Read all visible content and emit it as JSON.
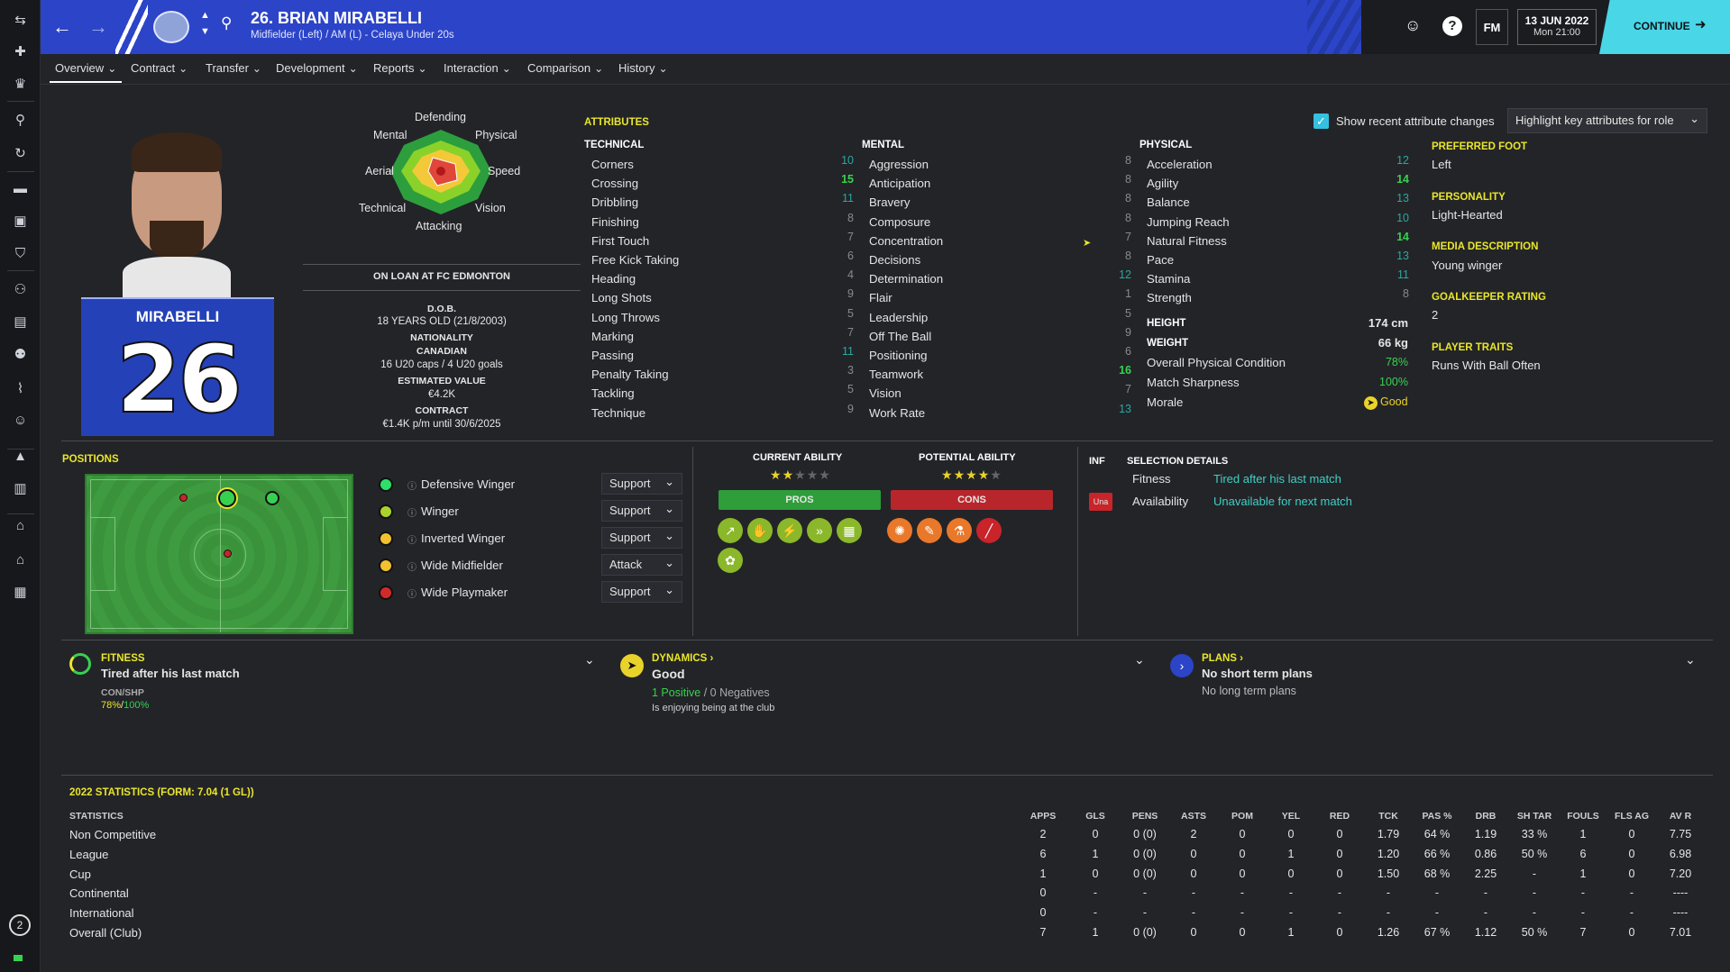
{
  "header": {
    "title": "26. BRIAN MIRABELLI",
    "subtitle": "Midfielder (Left) / AM (L) - Celaya Under 20s",
    "date": "13 JUN 2022",
    "time": "Mon 21:00",
    "fm": "FM",
    "continue": "CONTINUE",
    "help": "?"
  },
  "tabs": [
    "Overview",
    "Contract",
    "Transfer",
    "Development",
    "Reports",
    "Interaction",
    "Comparison",
    "History"
  ],
  "radar": {
    "labels": {
      "top": "Defending",
      "tl": "Mental",
      "tr": "Physical",
      "l": "Aerial",
      "r": "Speed",
      "bl": "Technical",
      "br": "Vision",
      "bottom": "Attacking"
    }
  },
  "loan": "ON LOAN AT FC EDMONTON",
  "info": {
    "dob_label": "D.O.B.",
    "dob": "18 YEARS OLD (21/8/2003)",
    "nat_label": "NATIONALITY",
    "nat": "CANADIAN",
    "caps": "16 U20 caps / 4 U20 goals",
    "value_label": "ESTIMATED VALUE",
    "value": "€4.2K",
    "contract_label": "CONTRACT",
    "contract": "€1.4K p/m until 30/6/2025"
  },
  "shirt": {
    "name": "MIRABELLI",
    "number": "26"
  },
  "attributes": {
    "title": "ATTRIBUTES",
    "show_changes": "Show recent attribute changes",
    "highlight": "Highlight key attributes for role",
    "technical_title": "TECHNICAL",
    "mental_title": "MENTAL",
    "physical_title": "PHYSICAL",
    "technical": [
      [
        "Corners",
        "10"
      ],
      [
        "Crossing",
        "15"
      ],
      [
        "Dribbling",
        "11"
      ],
      [
        "Finishing",
        "8"
      ],
      [
        "First Touch",
        "7"
      ],
      [
        "Free Kick Taking",
        "6"
      ],
      [
        "Heading",
        "4"
      ],
      [
        "Long Shots",
        "9"
      ],
      [
        "Long Throws",
        "5"
      ],
      [
        "Marking",
        "7"
      ],
      [
        "Passing",
        "11"
      ],
      [
        "Penalty Taking",
        "3"
      ],
      [
        "Tackling",
        "5"
      ],
      [
        "Technique",
        "9"
      ]
    ],
    "mental": [
      [
        "Aggression",
        "8"
      ],
      [
        "Anticipation",
        "8"
      ],
      [
        "Bravery",
        "8"
      ],
      [
        "Composure",
        "8"
      ],
      [
        "Concentration",
        "7"
      ],
      [
        "Decisions",
        "8"
      ],
      [
        "Determination",
        "12"
      ],
      [
        "Flair",
        "1"
      ],
      [
        "Leadership",
        "5"
      ],
      [
        "Off The Ball",
        "9"
      ],
      [
        "Positioning",
        "6"
      ],
      [
        "Teamwork",
        "16"
      ],
      [
        "Vision",
        "7"
      ],
      [
        "Work Rate",
        "13"
      ]
    ],
    "physical": [
      [
        "Acceleration",
        "12"
      ],
      [
        "Agility",
        "14"
      ],
      [
        "Balance",
        "13"
      ],
      [
        "Jumping Reach",
        "10"
      ],
      [
        "Natural Fitness",
        "14"
      ],
      [
        "Pace",
        "13"
      ],
      [
        "Stamina",
        "11"
      ],
      [
        "Strength",
        "8"
      ]
    ],
    "height_label": "HEIGHT",
    "height": "174 cm",
    "weight_label": "WEIGHT",
    "weight": "66 kg",
    "opc_label": "Overall Physical Condition",
    "opc": "78%",
    "ms_label": "Match Sharpness",
    "ms": "100%",
    "morale_label": "Morale",
    "morale": "Good"
  },
  "side": {
    "foot_label": "PREFERRED FOOT",
    "foot": "Left",
    "pers_label": "PERSONALITY",
    "pers": "Light-Hearted",
    "media_label": "MEDIA DESCRIPTION",
    "media": "Young winger",
    "gk_label": "GOALKEEPER RATING",
    "gk": "2",
    "traits_label": "PLAYER TRAITS",
    "traits": "Runs With Ball Often"
  },
  "positions": {
    "title": "POSITIONS",
    "roles": [
      {
        "name": "Defensive Winger",
        "duty": "Support",
        "color": "#2ee06a"
      },
      {
        "name": "Winger",
        "duty": "Support",
        "color": "#a9d42b"
      },
      {
        "name": "Inverted Winger",
        "duty": "Support",
        "color": "#f2c12e"
      },
      {
        "name": "Wide Midfielder",
        "duty": "Attack",
        "color": "#f2c12e"
      },
      {
        "name": "Wide Playmaker",
        "duty": "Support",
        "color": "#d22a2a"
      }
    ]
  },
  "ability": {
    "current_label": "CURRENT ABILITY",
    "potential_label": "POTENTIAL ABILITY",
    "current_stars": 2,
    "potential_stars": 4,
    "pros": "PROS",
    "cons": "CONS"
  },
  "selection": {
    "inf": "INF",
    "title": "SELECTION DETAILS",
    "fitness_label": "Fitness",
    "fitness": "Tired after his last match",
    "avail_label": "Availability",
    "avail": "Unavailable for next match",
    "badge": "Una"
  },
  "fitness": {
    "title": "FITNESS",
    "text": "Tired after his last match",
    "con_label": "CON/SHP",
    "con": "78%",
    "shp": "100%"
  },
  "dynamics": {
    "title": "DYNAMICS ›",
    "text": "Good",
    "positive": "1 Positive",
    "negatives": "0 Negatives",
    "note": "Is enjoying being at the club"
  },
  "plans": {
    "title": "PLANS ›",
    "text": "No short term plans",
    "sub": "No long term plans"
  },
  "stats": {
    "title": "2022 STATISTICS (FORM: 7.04 (1 GL))",
    "headers": [
      "STATISTICS",
      "APPS",
      "GLS",
      "PENS",
      "ASTS",
      "POM",
      "YEL",
      "RED",
      "TCK",
      "PAS %",
      "DRB",
      "SH TAR",
      "FOULS",
      "FLS AG",
      "AV R"
    ],
    "rows": [
      [
        "Non Competitive",
        "2",
        "0",
        "0 (0)",
        "2",
        "0",
        "0",
        "0",
        "1.79",
        "64 %",
        "1.19",
        "33 %",
        "1",
        "0",
        "7.75"
      ],
      [
        "League",
        "6",
        "1",
        "0 (0)",
        "0",
        "0",
        "1",
        "0",
        "1.20",
        "66 %",
        "0.86",
        "50 %",
        "6",
        "0",
        "6.98"
      ],
      [
        "Cup",
        "1",
        "0",
        "0 (0)",
        "0",
        "0",
        "0",
        "0",
        "1.50",
        "68 %",
        "2.25",
        "-",
        "1",
        "0",
        "7.20"
      ],
      [
        "Continental",
        "0",
        "-",
        "-",
        "-",
        "-",
        "-",
        "-",
        "-",
        "-",
        "-",
        "-",
        "-",
        "-",
        "----"
      ],
      [
        "International",
        "0",
        "-",
        "-",
        "-",
        "-",
        "-",
        "-",
        "-",
        "-",
        "-",
        "-",
        "-",
        "-",
        "----"
      ],
      [
        "Overall (Club)",
        "7",
        "1",
        "0 (0)",
        "0",
        "0",
        "1",
        "0",
        "1.26",
        "67 %",
        "1.12",
        "50 %",
        "7",
        "0",
        "7.01"
      ]
    ]
  },
  "notif_count": "2",
  "colors": {
    "accent": "#e9e62a",
    "blue": "#2c44c8",
    "green": "#37d150",
    "teal": "#3fd0c4",
    "red": "#c8242a"
  }
}
